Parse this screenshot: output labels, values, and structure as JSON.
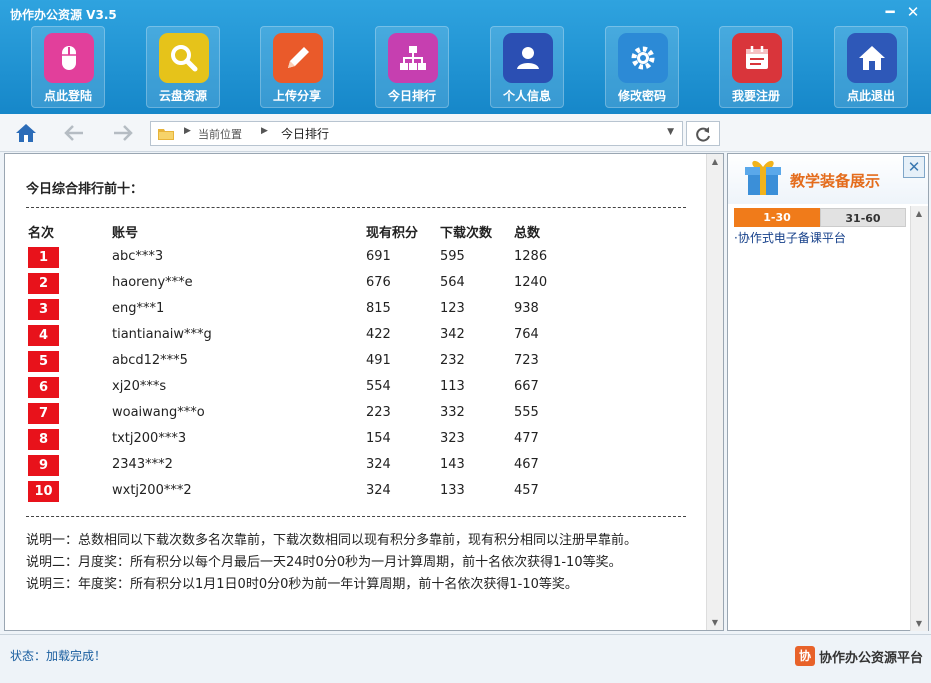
{
  "app": {
    "title": "协作办公资源  V3.5",
    "minimize": "━",
    "close": "✕"
  },
  "toolbar": [
    {
      "label": "点此登陆",
      "icon": "mouse-icon",
      "color": "#e23f9b"
    },
    {
      "label": "云盘资源",
      "icon": "magnifier-icon",
      "color": "#e6c31a"
    },
    {
      "label": "上传分享",
      "icon": "pencil-icon",
      "color": "#ea5a2a"
    },
    {
      "label": "今日排行",
      "icon": "org-chart-icon",
      "color": "#c63fb0"
    },
    {
      "label": "个人信息",
      "icon": "user-icon",
      "color": "#2b4fb3"
    },
    {
      "label": "修改密码",
      "icon": "gear-icon",
      "color": "#2c8ad6"
    },
    {
      "label": "我要注册",
      "icon": "calendar-icon",
      "color": "#d9353b"
    },
    {
      "label": "点此退出",
      "icon": "home-icon",
      "color": "#2e58b8"
    }
  ],
  "nav": {
    "location_label": "当前位置",
    "current_page": "今日排行"
  },
  "ranking": {
    "title": "今日综合排行前十：",
    "columns": {
      "rank": "名次",
      "account": "账号",
      "points": "现有积分",
      "downloads": "下载次数",
      "total": "总数"
    },
    "rows": [
      {
        "rank": "1",
        "account": "abc***3",
        "points": "691",
        "downloads": "595",
        "total": "1286"
      },
      {
        "rank": "2",
        "account": "haoreny***e",
        "points": "676",
        "downloads": "564",
        "total": "1240"
      },
      {
        "rank": "3",
        "account": "eng***1",
        "points": "815",
        "downloads": "123",
        "total": "938"
      },
      {
        "rank": "4",
        "account": "tiantianaiw***g",
        "points": "422",
        "downloads": "342",
        "total": "764"
      },
      {
        "rank": "5",
        "account": "abcd12***5",
        "points": "491",
        "downloads": "232",
        "total": "723"
      },
      {
        "rank": "6",
        "account": "xj20***s",
        "points": "554",
        "downloads": "113",
        "total": "667"
      },
      {
        "rank": "7",
        "account": "woaiwang***o",
        "points": "223",
        "downloads": "332",
        "total": "555"
      },
      {
        "rank": "8",
        "account": "txtj200***3",
        "points": "154",
        "downloads": "323",
        "total": "477"
      },
      {
        "rank": "9",
        "account": "2343***2",
        "points": "324",
        "downloads": "143",
        "total": "467"
      },
      {
        "rank": "10",
        "account": "wxtj200***2",
        "points": "324",
        "downloads": "133",
        "total": "457"
      }
    ],
    "notes": [
      "说明一：总数相同以下载次数多名次靠前，下载次数相同以现有积分多靠前，现有积分相同以注册早靠前。",
      "说明二：月度奖：所有积分以每个月最后一天24时0分0秒为一月计算周期，前十名依次获得1-10等奖。",
      "说明三：年度奖：所有积分以1月1日0时0分0秒为前一年计算周期，前十名依次获得1-10等奖。"
    ]
  },
  "side_panel": {
    "title": "教学装备展示",
    "tabs": [
      "1-30",
      "31-60"
    ],
    "items": [
      "·协作式电子备课平台"
    ]
  },
  "status": {
    "text": "状态：加载完成！",
    "brand_logo": "协",
    "brand_name": "协作办公资源平台"
  }
}
